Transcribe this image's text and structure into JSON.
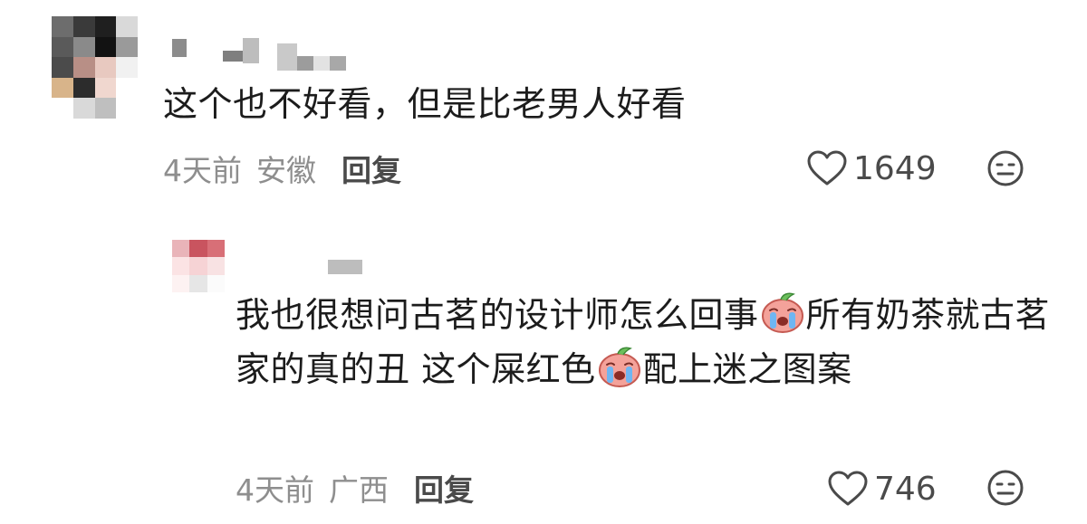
{
  "comment": {
    "text_part1": "这个也不好看，但是比老男人好看",
    "time": "4天前",
    "region": "安徽",
    "reply_label": "回复",
    "like_count": "1649"
  },
  "reply": {
    "text_before_emoji1": "我也很想问古茗的设计师怎么回事",
    "text_after_emoji1": "所有奶茶就古茗家的真的丑 这个屎红色",
    "text_after_emoji2": "配上迷之图案",
    "emoji_icon": "crying-peach-icon",
    "time": "4天前",
    "region": "广西",
    "reply_label": "回复",
    "like_count": "746"
  },
  "icons": {
    "like": "heart-outline-icon",
    "dislike": "meh-face-icon"
  },
  "colors": {
    "text": "#1c1c1c",
    "meta": "#8e8e8e",
    "action": "#4a4a4a",
    "emoji_skin": "#f4a29a"
  }
}
